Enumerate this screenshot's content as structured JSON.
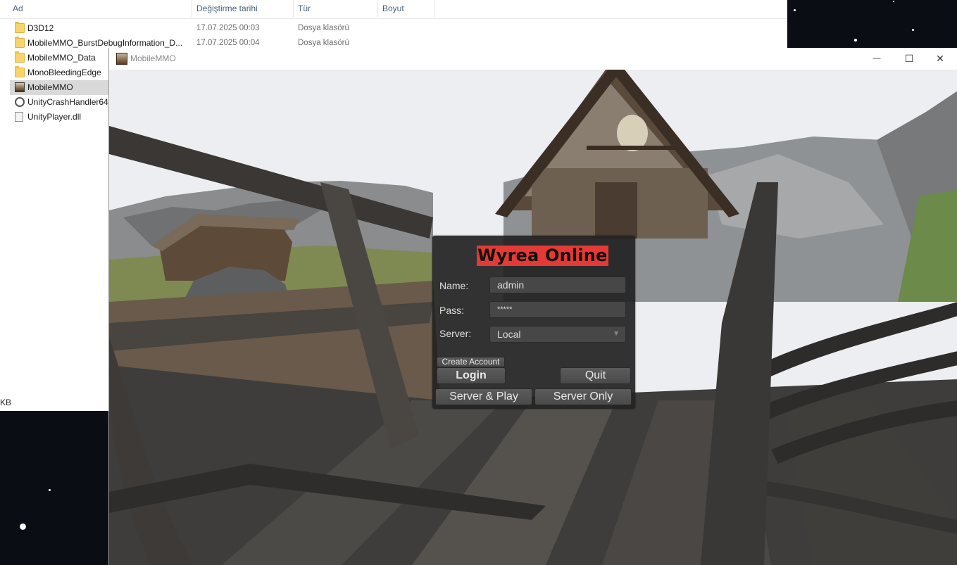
{
  "explorer": {
    "columns": [
      "Ad",
      "Değiştirme tarihi",
      "Tür",
      "Boyut"
    ],
    "files": [
      {
        "name": "D3D12",
        "date": "17.07.2025 00:03",
        "type": "Dosya klasörü",
        "icon": "folder-icon"
      },
      {
        "name": "MobileMMO_BurstDebugInformation_D...",
        "date": "17.07.2025 00:04",
        "type": "Dosya klasörü",
        "icon": "folder-icon"
      },
      {
        "name": "MobileMMO_Data",
        "date": "",
        "type": "",
        "icon": "folder-icon"
      },
      {
        "name": "MonoBleedingEdge",
        "date": "",
        "type": "",
        "icon": "folder-icon"
      },
      {
        "name": "MobileMMO",
        "date": "",
        "type": "",
        "icon": "app-icon"
      },
      {
        "name": "UnityCrashHandler64",
        "date": "",
        "type": "",
        "icon": "unity-icon"
      },
      {
        "name": "UnityPlayer.dll",
        "date": "",
        "type": "",
        "icon": "dll-icon"
      }
    ],
    "size_fragment": "KB"
  },
  "game_window": {
    "title": "MobileMMO",
    "minimize": "—",
    "maximize": "☐",
    "close": "✕"
  },
  "login": {
    "title": "Wyrea Online",
    "name_label": "Name:",
    "name_value": "admin",
    "pass_label": "Pass:",
    "pass_value": "*****",
    "server_label": "Server:",
    "server_value": "Local",
    "create_account": "Create Account",
    "login_button": "Login",
    "quit_button": "Quit",
    "server_play_button": "Server & Play",
    "server_only_button": "Server Only",
    "title_color": "#e53935"
  }
}
